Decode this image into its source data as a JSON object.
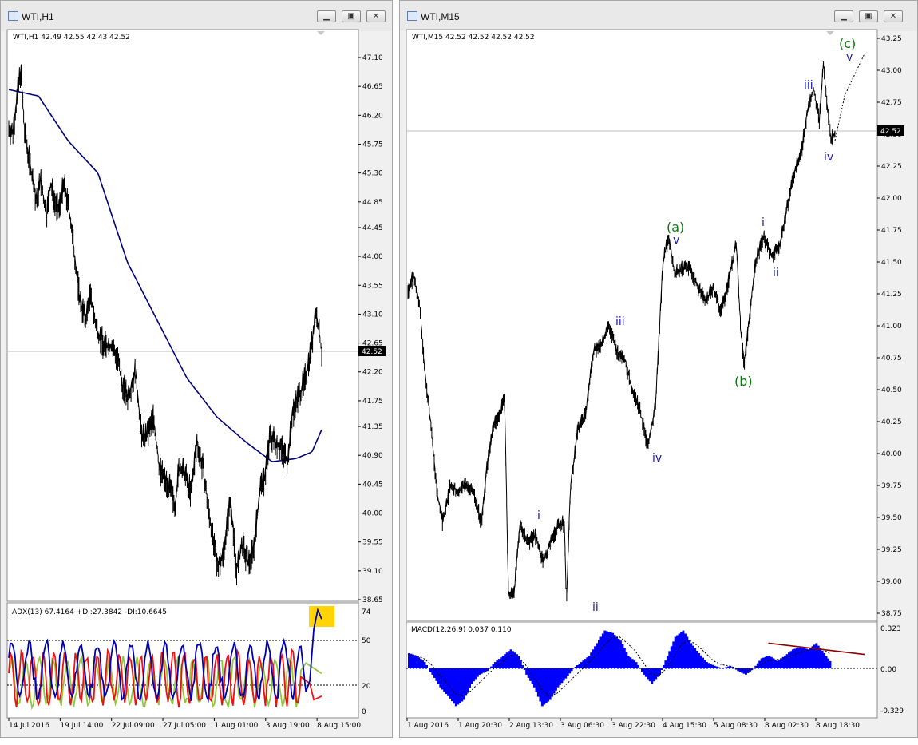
{
  "left_window": {
    "title": "WTI,H1",
    "buttons": {
      "minimize": "▁",
      "maximize": "▣",
      "close": "✕"
    },
    "header": "WTI,H1  42.49 42.55 42.43 42.52",
    "price_tag": "42.52",
    "price_ticks": [
      "47.10",
      "46.65",
      "46.20",
      "45.75",
      "45.30",
      "44.85",
      "44.45",
      "44.00",
      "43.55",
      "43.10",
      "42.65",
      "42.20",
      "41.75",
      "41.35",
      "40.90",
      "40.45",
      "40.00",
      "39.55",
      "39.10",
      "38.65"
    ],
    "time_ticks": [
      "14 Jul 2016",
      "19 Jul 14:00",
      "22 Jul 09:00",
      "27 Jul 05:00",
      "1 Aug 01:00",
      "3 Aug 19:00",
      "8 Aug 15:00"
    ],
    "indicator": {
      "header": "ADX(13) 67.4164 +DI:27.3842 -DI:10.6645",
      "ticks": [
        "74",
        "50",
        "20",
        "0"
      ],
      "adx_current": 67.4164,
      "plus_di_current": 27.3842,
      "minus_di_current": 10.6645
    }
  },
  "right_window": {
    "title": "WTI,M15",
    "buttons": {
      "minimize": "▁",
      "maximize": "▣",
      "close": "✕"
    },
    "header": "WTI,M15  42.52 42.52 42.52 42.52",
    "price_tag": "42.52",
    "price_ticks": [
      "43.25",
      "43.00",
      "42.75",
      "42.50",
      "42.25",
      "42.00",
      "41.75",
      "41.50",
      "41.25",
      "41.00",
      "40.75",
      "40.50",
      "40.25",
      "40.00",
      "39.75",
      "39.50",
      "39.25",
      "39.00",
      "38.75"
    ],
    "time_ticks": [
      "1 Aug 2016",
      "1 Aug 20:30",
      "2 Aug 13:30",
      "3 Aug 06:30",
      "3 Aug 22:30",
      "4 Aug 15:30",
      "5 Aug 08:30",
      "8 Aug 02:30",
      "8 Aug 18:30"
    ],
    "wave_labels": {
      "i1": "i",
      "ii1": "ii",
      "iii1": "iii",
      "iv1": "iv",
      "v1": "v",
      "a": "(a)",
      "b": "(b)",
      "i2": "i",
      "ii2": "ii",
      "iii2": "iii",
      "iv2": "iv",
      "v2": "v",
      "c": "(c)"
    },
    "indicator": {
      "header": "MACD(12,26,9) 0.037 0.110",
      "ticks": [
        "0.323",
        "0.00",
        "-0.329"
      ],
      "macd_current": 0.037,
      "signal_current": 0.11
    }
  },
  "colors": {
    "price": "#000000",
    "moving_average": "#00007f",
    "adx": "#0000b0",
    "plus_di": "#8fc93a",
    "minus_di": "#ee1111",
    "macd_histogram": "#0000ff",
    "wave_minor": "#1a1ab5",
    "wave_major": "#0a7a0a",
    "highlight": "#ffd400",
    "trendline": "#8b0000"
  },
  "chart_data": [
    {
      "type": "line",
      "title": "WTI,H1",
      "ylim": [
        38.65,
        47.1
      ],
      "x": [
        "14 Jul 2016",
        "19 Jul 14:00",
        "22 Jul 09:00",
        "27 Jul 05:00",
        "1 Aug 01:00",
        "3 Aug 19:00",
        "8 Aug 15:00"
      ],
      "series": [
        {
          "name": "WTI,H1",
          "values": [
            45.9,
            44.9,
            43.0,
            41.3,
            40.0,
            40.5,
            42.52
          ]
        }
      ],
      "keypoints": [
        [
          0,
          46.0
        ],
        [
          4,
          45.9
        ],
        [
          8,
          46.4
        ],
        [
          12,
          46.9
        ],
        [
          16,
          45.9
        ],
        [
          22,
          45.4
        ],
        [
          28,
          44.8
        ],
        [
          32,
          45.2
        ],
        [
          38,
          44.6
        ],
        [
          42,
          45.1
        ],
        [
          46,
          44.9
        ],
        [
          50,
          44.7
        ],
        [
          56,
          45.1
        ],
        [
          62,
          44.6
        ],
        [
          68,
          43.8
        ],
        [
          72,
          43.3
        ],
        [
          78,
          43.0
        ],
        [
          82,
          43.4
        ],
        [
          88,
          42.9
        ],
        [
          96,
          42.6
        ],
        [
          104,
          42.6
        ],
        [
          110,
          42.4
        ],
        [
          114,
          42.0
        ],
        [
          120,
          41.8
        ],
        [
          128,
          42.2
        ],
        [
          134,
          41.2
        ],
        [
          140,
          41.2
        ],
        [
          146,
          41.5
        ],
        [
          152,
          40.7
        ],
        [
          158,
          40.5
        ],
        [
          162,
          40.4
        ],
        [
          168,
          40.1
        ],
        [
          172,
          40.7
        ],
        [
          178,
          40.6
        ],
        [
          184,
          40.3
        ],
        [
          190,
          41.1
        ],
        [
          196,
          40.7
        ],
        [
          202,
          40.0
        ],
        [
          206,
          39.6
        ],
        [
          210,
          39.2
        ],
        [
          216,
          39.3
        ],
        [
          224,
          40.2
        ],
        [
          230,
          39.1
        ],
        [
          236,
          39.5
        ],
        [
          242,
          39.2
        ],
        [
          248,
          39.5
        ],
        [
          254,
          40.4
        ],
        [
          258,
          40.5
        ],
        [
          264,
          41.2
        ],
        [
          270,
          41.1
        ],
        [
          276,
          41.0
        ],
        [
          282,
          40.8
        ],
        [
          286,
          41.5
        ],
        [
          292,
          41.8
        ],
        [
          298,
          42.0
        ],
        [
          306,
          42.6
        ],
        [
          310,
          43.15
        ],
        [
          316,
          42.52
        ]
      ],
      "moving_average": [
        [
          0,
          46.6
        ],
        [
          30,
          46.5
        ],
        [
          60,
          45.8
        ],
        [
          90,
          45.3
        ],
        [
          120,
          43.9
        ],
        [
          150,
          43.0
        ],
        [
          180,
          42.1
        ],
        [
          210,
          41.5
        ],
        [
          240,
          41.1
        ],
        [
          266,
          40.8
        ],
        [
          290,
          40.85
        ],
        [
          306,
          40.95
        ],
        [
          316,
          41.3
        ]
      ],
      "adx": [
        [
          300,
          14
        ],
        [
          304,
          22
        ],
        [
          308,
          60
        ],
        [
          312,
          74
        ],
        [
          316,
          67.4164
        ]
      ],
      "plus_di": [
        [
          300,
          35
        ],
        [
          316,
          27.3842
        ]
      ],
      "minus_di": [
        [
          300,
          24
        ],
        [
          316,
          10.6645
        ]
      ]
    },
    {
      "type": "line",
      "title": "WTI,M15",
      "ylim": [
        38.75,
        43.25
      ],
      "x": [
        "1 Aug 2016",
        "1 Aug 20:30",
        "2 Aug 13:30",
        "3 Aug 06:30",
        "3 Aug 22:30",
        "4 Aug 15:30",
        "5 Aug 08:30",
        "8 Aug 02:30",
        "8 Aug 18:30"
      ],
      "series": [
        {
          "name": "WTI,M15",
          "values": [
            41.3,
            39.7,
            39.8,
            39.3,
            40.7,
            41.45,
            41.3,
            41.6,
            42.52
          ]
        }
      ],
      "keypoints": [
        [
          0,
          41.25
        ],
        [
          3,
          41.4
        ],
        [
          6,
          41.15
        ],
        [
          9,
          40.6
        ],
        [
          12,
          40.2
        ],
        [
          15,
          39.7
        ],
        [
          18,
          39.45
        ],
        [
          22,
          39.75
        ],
        [
          26,
          39.7
        ],
        [
          30,
          39.75
        ],
        [
          34,
          39.7
        ],
        [
          38,
          39.45
        ],
        [
          41,
          39.9
        ],
        [
          44,
          40.2
        ],
        [
          47,
          40.3
        ],
        [
          50,
          40.45
        ],
        [
          52,
          38.9
        ],
        [
          55,
          38.9
        ],
        [
          58,
          39.45
        ],
        [
          62,
          39.3
        ],
        [
          66,
          39.35
        ],
        [
          70,
          39.15
        ],
        [
          74,
          39.3
        ],
        [
          78,
          39.45
        ],
        [
          81,
          39.45
        ],
        [
          82,
          38.8
        ],
        [
          84,
          39.7
        ],
        [
          88,
          40.2
        ],
        [
          92,
          40.3
        ],
        [
          96,
          40.8
        ],
        [
          100,
          40.85
        ],
        [
          104,
          41.0
        ],
        [
          108,
          40.8
        ],
        [
          112,
          40.75
        ],
        [
          116,
          40.5
        ],
        [
          120,
          40.35
        ],
        [
          124,
          40.05
        ],
        [
          128,
          40.35
        ],
        [
          130,
          40.9
        ],
        [
          132,
          41.5
        ],
        [
          135,
          41.7
        ],
        [
          138,
          41.4
        ],
        [
          142,
          41.45
        ],
        [
          146,
          41.45
        ],
        [
          150,
          41.3
        ],
        [
          154,
          41.2
        ],
        [
          158,
          41.3
        ],
        [
          162,
          41.1
        ],
        [
          166,
          41.35
        ],
        [
          170,
          41.65
        ],
        [
          172,
          41.0
        ],
        [
          174,
          40.7
        ],
        [
          177,
          41.1
        ],
        [
          180,
          41.5
        ],
        [
          184,
          41.7
        ],
        [
          188,
          41.55
        ],
        [
          192,
          41.6
        ],
        [
          196,
          41.9
        ],
        [
          200,
          42.2
        ],
        [
          204,
          42.4
        ],
        [
          207,
          42.7
        ],
        [
          210,
          42.85
        ],
        [
          213,
          42.6
        ],
        [
          215,
          43.05
        ],
        [
          217,
          42.7
        ],
        [
          219,
          42.45
        ],
        [
          221,
          42.52
        ]
      ],
      "projection": [
        [
          221,
          42.45
        ],
        [
          226,
          42.8
        ],
        [
          236,
          43.12
        ]
      ],
      "macd_histogram": [
        0.12,
        0.1,
        0.05,
        -0.05,
        -0.15,
        -0.22,
        -0.3,
        -0.25,
        -0.12,
        -0.05,
        -0.02,
        0.05,
        0.1,
        0.15,
        0.1,
        -0.05,
        -0.15,
        -0.3,
        -0.25,
        -0.15,
        -0.08,
        0.0,
        0.05,
        0.1,
        0.2,
        0.3,
        0.28,
        0.22,
        0.1,
        0.05,
        -0.05,
        -0.12,
        -0.05,
        0.1,
        0.25,
        0.3,
        0.2,
        0.12,
        0.05,
        0.02,
        0.0,
        0.02,
        -0.02,
        -0.05,
        0.0,
        0.08,
        0.1,
        0.06,
        0.1,
        0.15,
        0.17,
        0.15,
        0.2,
        0.12,
        0.037
      ],
      "macd_signal": [
        0.1,
        0.1,
        0.08,
        0.03,
        -0.05,
        -0.12,
        -0.2,
        -0.22,
        -0.18,
        -0.12,
        -0.06,
        0.0,
        0.05,
        0.1,
        0.1,
        0.03,
        -0.06,
        -0.16,
        -0.22,
        -0.2,
        -0.14,
        -0.08,
        -0.02,
        0.04,
        0.1,
        0.18,
        0.24,
        0.25,
        0.2,
        0.14,
        0.05,
        -0.04,
        -0.06,
        0.0,
        0.1,
        0.2,
        0.22,
        0.18,
        0.12,
        0.06,
        0.03,
        0.02,
        0.0,
        -0.02,
        -0.01,
        0.03,
        0.06,
        0.07,
        0.08,
        0.1,
        0.13,
        0.14,
        0.16,
        0.15,
        0.11
      ],
      "macd_trendline": [
        [
          46,
          0.2
        ],
        [
          54,
          0.11
        ]
      ]
    }
  ]
}
